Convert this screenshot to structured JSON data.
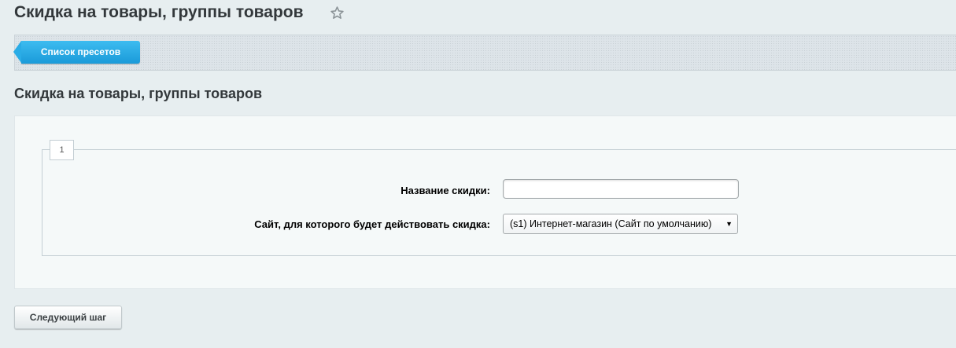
{
  "header": {
    "title": "Скидка на товары, группы товаров",
    "favorite_icon": "star-outline-icon"
  },
  "toolbar": {
    "preset_list_label": "Список пресетов",
    "accent_color": "#1a9ad9"
  },
  "section": {
    "title": "Скидка на товары, группы товаров"
  },
  "form": {
    "step_number": "1",
    "fields": {
      "name": {
        "label": "Название скидки:",
        "value": "",
        "placeholder": ""
      },
      "site": {
        "label": "Сайт, для которого будет действовать скидка:",
        "selected": "(s1) Интернет-магазин (Сайт по умолчанию)"
      }
    }
  },
  "footer": {
    "next_label": "Следующий шаг"
  }
}
